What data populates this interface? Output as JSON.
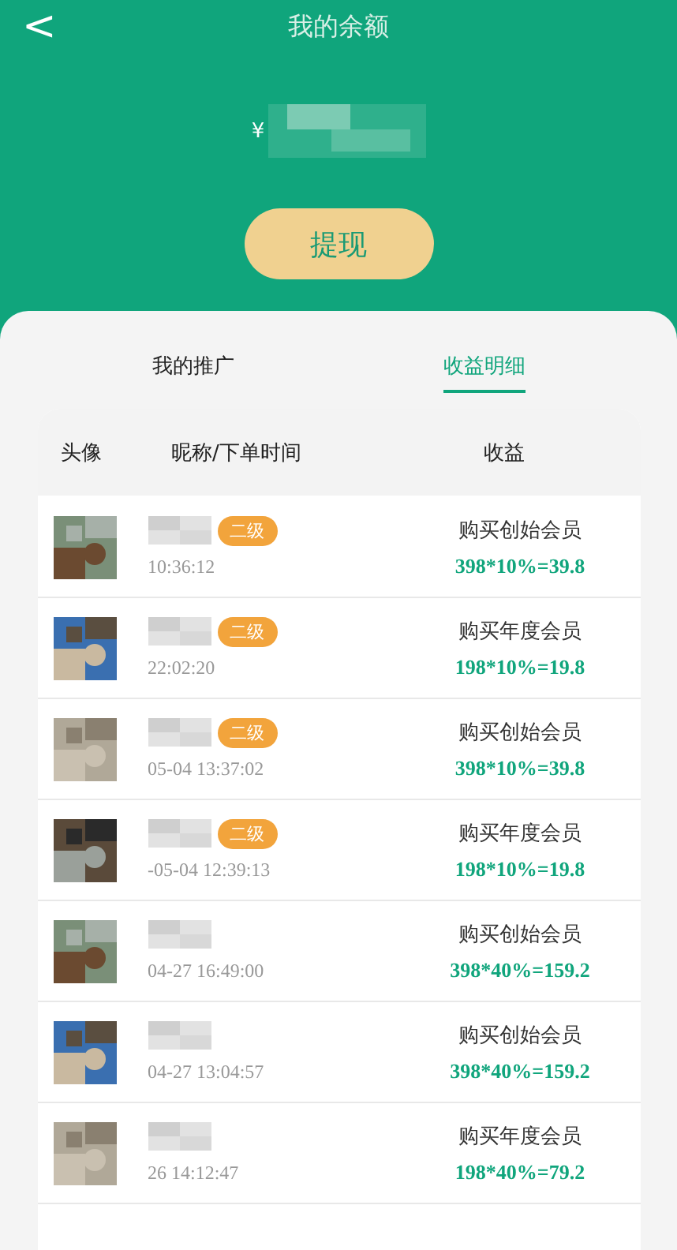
{
  "header": {
    "title": "我的余额",
    "back": "<"
  },
  "balance": {
    "currency": "¥"
  },
  "withdraw_button": "提现",
  "tabs": [
    {
      "label": "我的推广",
      "selected": false
    },
    {
      "label": "收益明细",
      "selected": true
    }
  ],
  "table": {
    "columns": [
      "头像",
      "昵称/下单时间",
      "收益"
    ],
    "rows": [
      {
        "level": "二级",
        "time": "10:36:12",
        "item": "购买创始会员",
        "amount": "398*10%=39.8"
      },
      {
        "level": "二级",
        "time": "22:02:20",
        "item": "购买年度会员",
        "amount": "198*10%=19.8"
      },
      {
        "level": "二级",
        "time": "05-04 13:37:02",
        "item": "购买创始会员",
        "amount": "398*10%=39.8"
      },
      {
        "level": "二级",
        "time": "-05-04 12:39:13",
        "item": "购买年度会员",
        "amount": "198*10%=19.8"
      },
      {
        "time": "04-27 16:49:00",
        "item": "购买创始会员",
        "amount": "398*40%=159.2"
      },
      {
        "time": "04-27 13:04:57",
        "item": "购买创始会员",
        "amount": "398*40%=159.2"
      },
      {
        "time": "26 14:12:47",
        "item": "购买年度会员",
        "amount": "198*40%=79.2"
      }
    ]
  }
}
